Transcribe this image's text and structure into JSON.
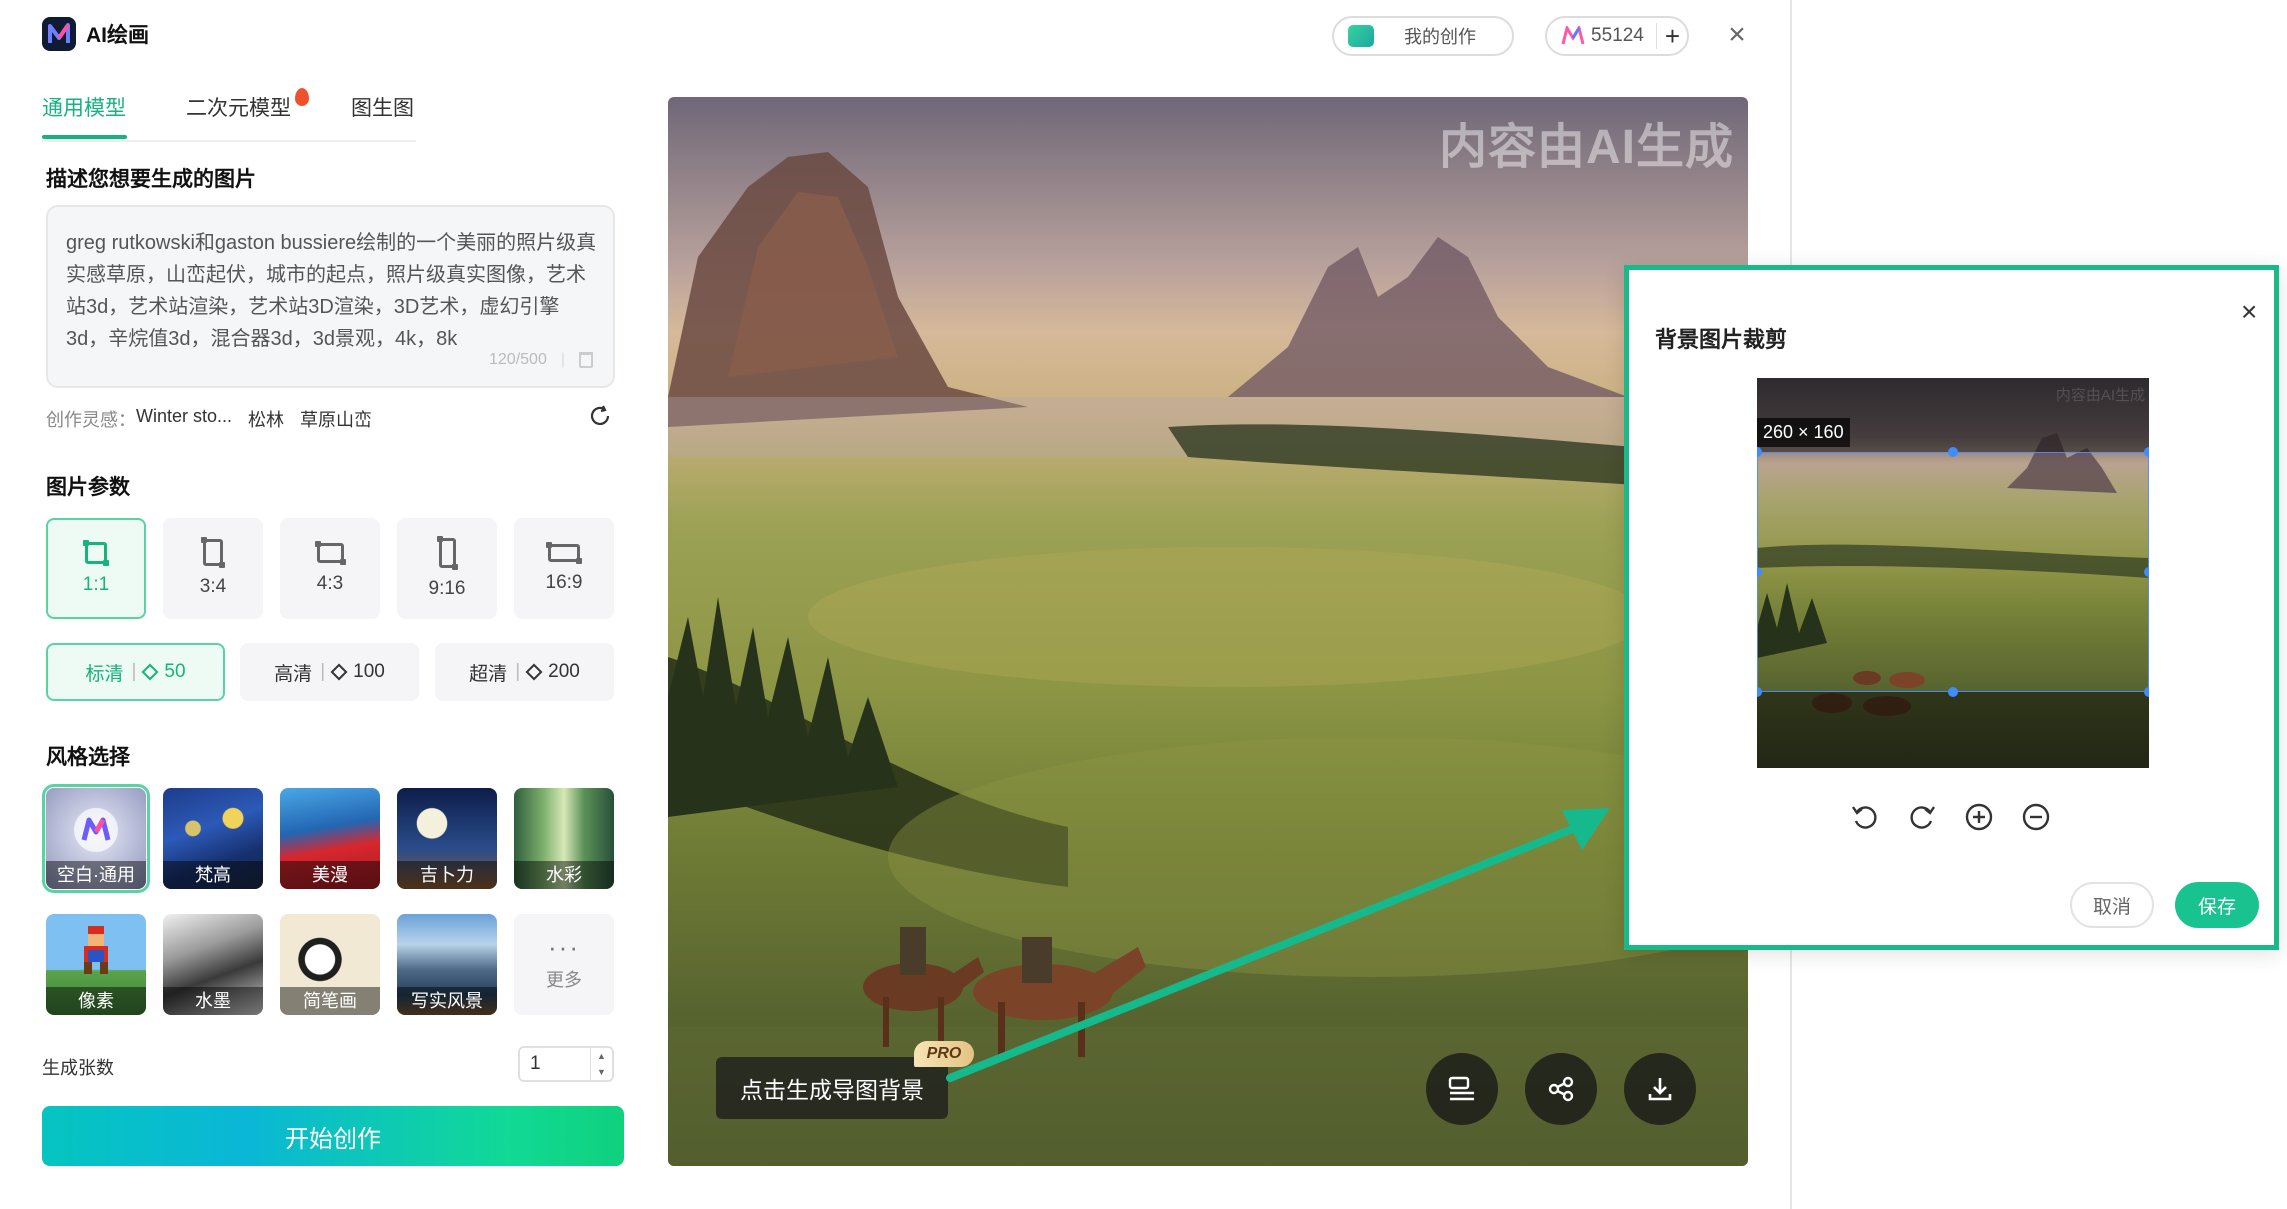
{
  "app": {
    "title": "AI绘画"
  },
  "header": {
    "my_creations": "我的创作",
    "credits": "55124",
    "add": "+",
    "close": "×"
  },
  "tabs": [
    {
      "label": "通用模型",
      "active": true
    },
    {
      "label": "二次元模型",
      "active": false
    },
    {
      "label": "图生图",
      "active": false
    }
  ],
  "prompt": {
    "heading": "描述您想要生成的图片",
    "text": "greg rutkowski和gaston bussiere绘制的一个美丽的照片级真实感草原，山峦起伏，城市的起点，照片级真实图像，艺术站3d，艺术站渲染，艺术站3D渲染，3D艺术，虚幻引擎3d，辛烷值3d，混合器3d，3d景观，4k，8k",
    "count": "120/500"
  },
  "inspiration": {
    "label": "创作灵感：",
    "items": [
      "Winter sto...",
      "松林",
      "草原山峦"
    ]
  },
  "params": {
    "heading": "图片参数",
    "ratios": [
      {
        "label": "1:1",
        "active": true
      },
      {
        "label": "3:4",
        "active": false
      },
      {
        "label": "4:3",
        "active": false
      },
      {
        "label": "9:16",
        "active": false
      },
      {
        "label": "16:9",
        "active": false
      }
    ],
    "qualities": [
      {
        "label": "标清",
        "cost": "50",
        "active": true
      },
      {
        "label": "高清",
        "cost": "100",
        "active": false
      },
      {
        "label": "超清",
        "cost": "200",
        "active": false
      }
    ]
  },
  "styles": {
    "heading": "风格选择",
    "items": [
      {
        "label": "空白·通用",
        "active": true
      },
      {
        "label": "梵高"
      },
      {
        "label": "美漫"
      },
      {
        "label": "吉卜力"
      },
      {
        "label": "水彩"
      },
      {
        "label": "像素"
      },
      {
        "label": "水墨"
      },
      {
        "label": "简笔画"
      },
      {
        "label": "写实风景"
      }
    ],
    "more": "更多",
    "more_dots": "···"
  },
  "count": {
    "label": "生成张数",
    "value": "1"
  },
  "start_button": "开始创作",
  "preview": {
    "watermark": "内容由AI生成",
    "bg_button": "点击生成导图背景",
    "pro": "PRO"
  },
  "crop_dialog": {
    "title": "背景图片裁剪",
    "dims": "260 × 160",
    "cancel": "取消",
    "save": "保存",
    "close": "×"
  },
  "colors": {
    "accent": "#16b27f",
    "dialog_border": "#19b98a",
    "save": "#19c38f"
  }
}
